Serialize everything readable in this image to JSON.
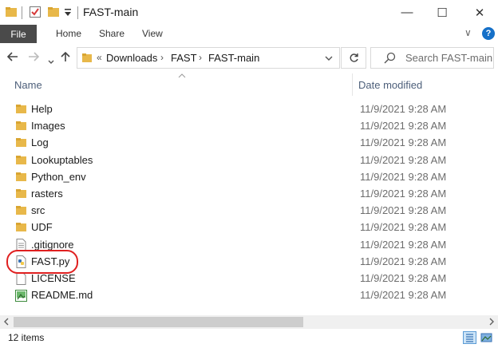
{
  "window": {
    "title": "FAST-main",
    "minimize_glyph": "—",
    "maximize_glyph": "☐",
    "close_glyph": "✕"
  },
  "ribbon": {
    "tabs": [
      "File",
      "Home",
      "Share",
      "View"
    ],
    "expand_glyph": "∨",
    "help_glyph": "?"
  },
  "address": {
    "overflow_glyph": "«",
    "breadcrumbs": [
      "Downloads",
      "FAST",
      "FAST-main"
    ],
    "separator_glyph": "›"
  },
  "search": {
    "placeholder": "Search FAST-main"
  },
  "columns": {
    "name": "Name",
    "date_modified": "Date modified"
  },
  "files": [
    {
      "name": "Help",
      "date": "11/9/2021 9:28 AM",
      "icon": "folder-icon"
    },
    {
      "name": "Images",
      "date": "11/9/2021 9:28 AM",
      "icon": "folder-icon"
    },
    {
      "name": "Log",
      "date": "11/9/2021 9:28 AM",
      "icon": "folder-icon"
    },
    {
      "name": "Lookuptables",
      "date": "11/9/2021 9:28 AM",
      "icon": "folder-icon"
    },
    {
      "name": "Python_env",
      "date": "11/9/2021 9:28 AM",
      "icon": "folder-icon"
    },
    {
      "name": "rasters",
      "date": "11/9/2021 9:28 AM",
      "icon": "folder-icon"
    },
    {
      "name": "src",
      "date": "11/9/2021 9:28 AM",
      "icon": "folder-icon"
    },
    {
      "name": "UDF",
      "date": "11/9/2021 9:28 AM",
      "icon": "folder-icon"
    },
    {
      "name": ".gitignore",
      "date": "11/9/2021 9:28 AM",
      "icon": "text-file-icon"
    },
    {
      "name": "FAST.py",
      "date": "11/9/2021 9:28 AM",
      "icon": "python-file-icon"
    },
    {
      "name": "LICENSE",
      "date": "11/9/2021 9:28 AM",
      "icon": "blank-file-icon"
    },
    {
      "name": "README.md",
      "date": "11/9/2021 9:28 AM",
      "icon": "markdown-file-icon"
    }
  ],
  "status": {
    "item_count": "12 items"
  },
  "colors": {
    "folder": "#e8b84a",
    "accent_blue": "#1570c8",
    "file_tab": "#4a4a4a",
    "highlight_ring": "#e02020"
  }
}
